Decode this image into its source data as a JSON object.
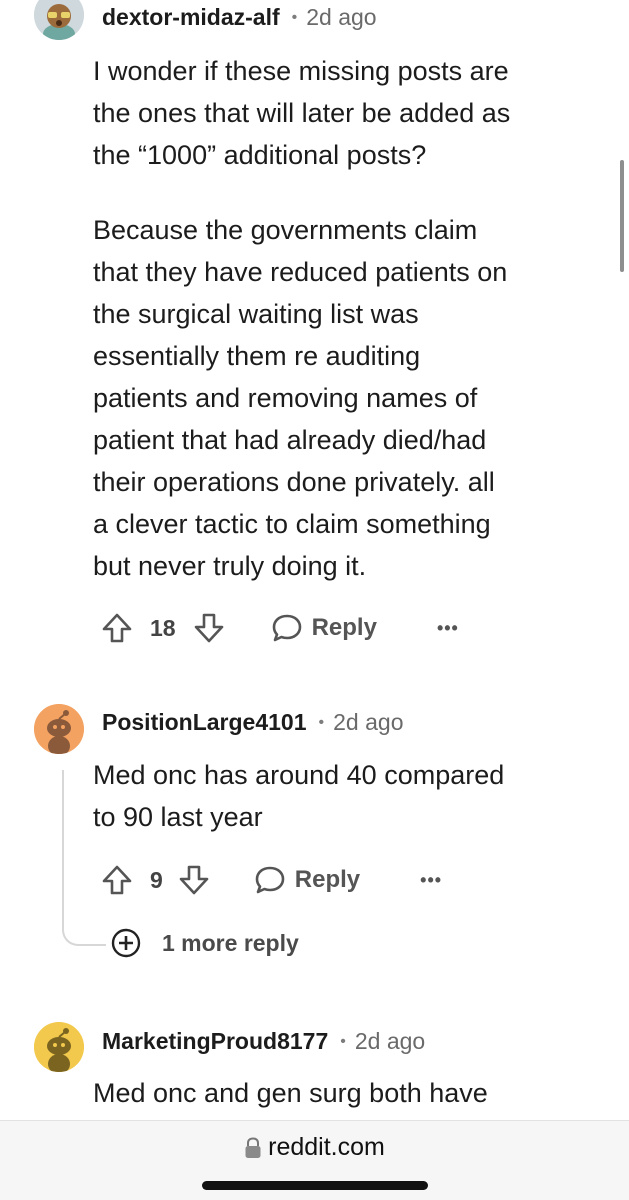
{
  "comments": [
    {
      "username": "dextor-midaz-alf",
      "time": "2d ago",
      "body_lines_1": [
        "I wonder if these missing posts are",
        "the ones that will later be added as",
        "the “1000” additional posts?"
      ],
      "body_lines_2": [
        "Because the governments claim",
        "that they have reduced patients on",
        "the surgical waiting list was",
        "essentially them re auditing",
        "patients and removing names of",
        "patient that had already died/had",
        "their operations done privately. all",
        "a clever tactic to claim something",
        "but never truly doing it."
      ],
      "votes": "18",
      "reply_label": "Reply",
      "more_label": "•••"
    },
    {
      "username": "PositionLarge4101",
      "time": "2d ago",
      "body_lines": [
        "Med onc has around 40 compared",
        "to 90 last year"
      ],
      "votes": "9",
      "reply_label": "Reply",
      "more_label": "•••",
      "more_replies": "1 more reply"
    },
    {
      "username": "MarketingProud8177",
      "time": "2d ago",
      "body_lines": [
        "Med onc and gen surg both have"
      ]
    }
  ],
  "browser": {
    "url": "reddit.com",
    "lock_icon": "lock-icon"
  },
  "colors": {
    "avatar_orange": "#F4A261",
    "avatar_yellow": "#F2C94C",
    "text": "#1c1c1c",
    "muted": "#6a6a6a"
  }
}
